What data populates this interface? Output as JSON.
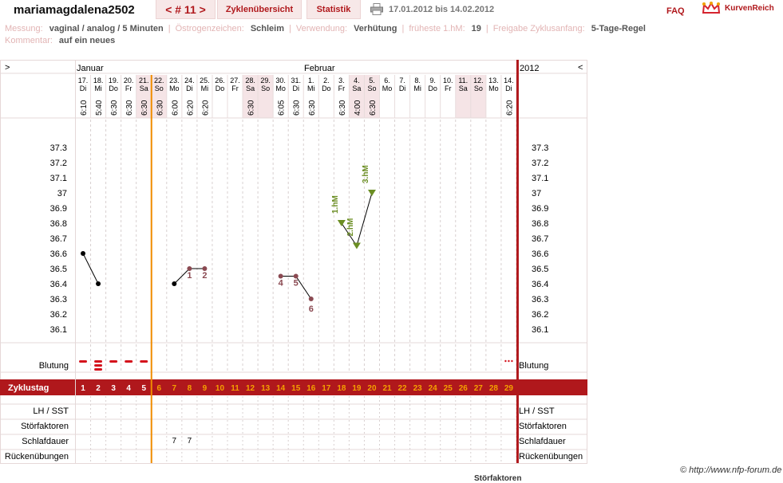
{
  "header": {
    "username": "mariamagdalena2502",
    "cycle_nav": "< # 11 >",
    "tab_overview": "Zyklenübersicht",
    "tab_stats": "Statistik",
    "date_range": "17.01.2012 bis 14.02.2012",
    "faq": "FAQ",
    "logo_text": "KurvenReich"
  },
  "info": {
    "messung_label": "Messung:",
    "messung_value": "vaginal / analog / 5 Minuten",
    "oestrogen_label": "Östrogenzeichen:",
    "oestrogen_value": "Schleim",
    "verwendung_label": "Verwendung:",
    "verwendung_value": "Verhütung",
    "hm_label": "früheste 1.hM:",
    "hm_value": "19",
    "freigabe_label": "Freigabe Zyklusanfang:",
    "freigabe_value": "5-Tage-Regel",
    "kommentar_label": "Kommentar:",
    "kommentar_value": "auf ein neues"
  },
  "chart": {
    "nav_left": ">",
    "nav_right": "<",
    "month_jan": "Januar",
    "month_feb": "Februar",
    "year": "2012",
    "dates": [
      "17.",
      "18.",
      "19.",
      "20.",
      "21.",
      "22.",
      "23.",
      "24.",
      "25.",
      "26.",
      "27.",
      "28.",
      "29.",
      "30.",
      "31.",
      "1.",
      "2.",
      "3.",
      "4.",
      "5.",
      "6.",
      "7.",
      "8.",
      "9.",
      "10.",
      "11.",
      "12.",
      "13.",
      "14."
    ],
    "weekdays": [
      "Di",
      "Mi",
      "Do",
      "Fr",
      "Sa",
      "So",
      "Mo",
      "Di",
      "Mi",
      "Do",
      "Fr",
      "Sa",
      "So",
      "Mo",
      "Di",
      "Mi",
      "Do",
      "Fr",
      "Sa",
      "So",
      "Mo",
      "Di",
      "Mi",
      "Do",
      "Fr",
      "Sa",
      "So",
      "Mo",
      "Di"
    ],
    "times": [
      "6:10",
      "5:40",
      "6:30",
      "6:30",
      "6:30",
      "6:30",
      "6:00",
      "6:20",
      "6:20",
      "",
      "",
      "6:30",
      "",
      "6:05",
      "6:30",
      "6:30",
      "",
      "6:30",
      "4:00",
      "6:30",
      "",
      "",
      "",
      "",
      "",
      "",
      "",
      "",
      "6:20"
    ],
    "y_labels": [
      "37.3",
      "37.2",
      "37.1",
      "37",
      "36.9",
      "36.8",
      "36.7",
      "36.6",
      "36.5",
      "36.4",
      "36.3",
      "36.2",
      "36.1"
    ],
    "row_blutung": "Blutung",
    "row_zyklustag": "Zyklustag",
    "row_lh": "LH / SST",
    "row_stoer": "Störfaktoren",
    "row_schlaf": "Schlafdauer",
    "row_ruecken": "Rückenübungen",
    "schlaf_values": [
      "",
      "",
      "",
      "",
      "",
      "",
      "7",
      "7",
      "",
      "",
      "",
      "",
      "",
      "",
      "",
      "",
      "",
      "",
      "",
      "",
      "",
      "",
      "",
      "",
      "",
      "",
      "",
      "",
      ""
    ],
    "cycle_days": [
      "1",
      "2",
      "3",
      "4",
      "5",
      "6",
      "7",
      "8",
      "9",
      "10",
      "11",
      "12",
      "13",
      "14",
      "15",
      "16",
      "17",
      "18",
      "19",
      "20",
      "21",
      "22",
      "23",
      "24",
      "25",
      "26",
      "27",
      "28",
      "29"
    ],
    "colors": {
      "accent": "#b0181c",
      "cover_line": "#f08c00",
      "highlight": "#f5e4e6",
      "grid": "#d8d0d0",
      "hm": "#6b8e23",
      "measure_low": "#8b4a52"
    }
  },
  "chart_data": {
    "type": "line",
    "x": [
      1,
      2,
      7,
      8,
      9,
      14,
      15,
      16,
      18,
      19,
      20
    ],
    "series": [
      {
        "values": [
          36.6,
          36.4
        ]
      },
      {
        "values": [
          36.4,
          36.5,
          36.5
        ]
      },
      {
        "values": [
          36.45,
          36.45,
          36.3
        ]
      },
      {
        "values": [
          36.8,
          36.65,
          37.0
        ]
      }
    ],
    "point_labels": [
      "1",
      "2",
      "4",
      "5",
      "6",
      "1.hM",
      "2.hM",
      "3.hM"
    ],
    "ylim": [
      36.1,
      37.3
    ]
  },
  "footer": {
    "copyright": "© http://www.nfp-forum.de",
    "cut_text": "Störfaktoren"
  }
}
